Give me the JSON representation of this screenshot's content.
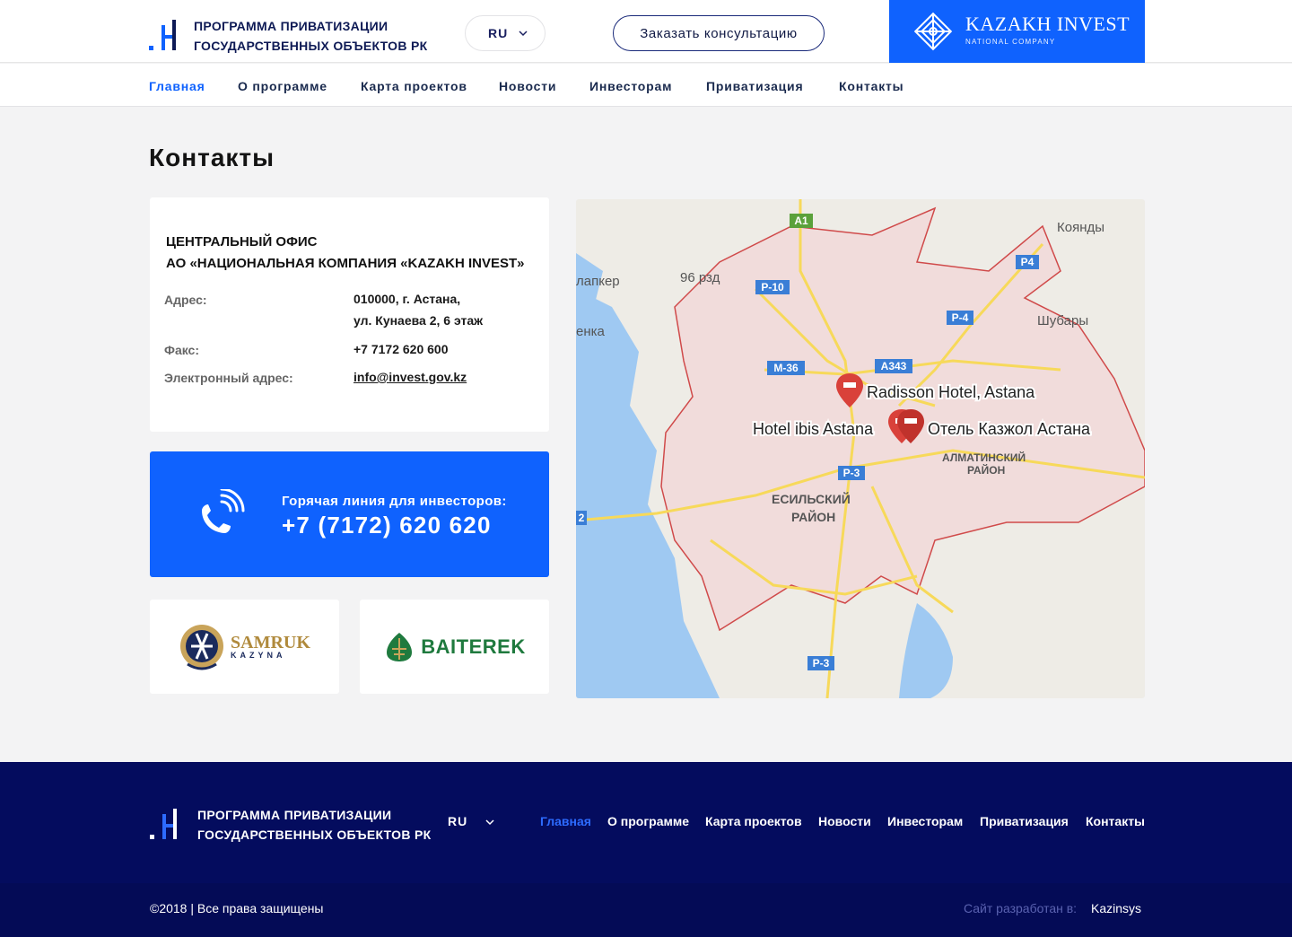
{
  "header": {
    "title_line1": "Программа приватизации",
    "title_line2": "государственных объектов РК",
    "lang": "RU",
    "consult_button": "Заказать консультацию",
    "kazakh_invest_name": "KAZAKH INVEST",
    "kazakh_invest_sub": "NATIONAL COMPANY"
  },
  "nav": {
    "items": [
      {
        "label": "Главная",
        "active": true
      },
      {
        "label": "О программе"
      },
      {
        "label": "Карта проектов"
      },
      {
        "label": "Новости"
      },
      {
        "label": "Инвесторам"
      },
      {
        "label": "Приватизация"
      },
      {
        "label": "Контакты"
      }
    ]
  },
  "main": {
    "page_title": "Контакты",
    "office": {
      "heading_line1": "Центральный офис",
      "heading_line2": "АО «Национальная компания «KAZAKH INVEST»",
      "address_label": "Адрес:",
      "address_line1": "010000, г. Астана,",
      "address_line2": "ул. Кунаева 2, 6 этаж",
      "fax_label": "Факс:",
      "fax_value": "+7 7172 620 600",
      "email_label": "Электронный адрес:",
      "email_value": "info@invest.gov.kz"
    },
    "hotline": {
      "label": "Горячая линия для инвесторов:",
      "number": "+7 (7172) 620 620"
    },
    "partners": {
      "samruk_line1": "SAMRUK",
      "samruk_line2": "KAZYNA",
      "baiterek": "BAITEREK"
    },
    "map": {
      "roads": [
        "A1",
        "P4",
        "P-10",
        "P-4",
        "M-36",
        "A343",
        "P-3",
        "P-3",
        "2"
      ],
      "places": [
        "Коянды",
        "96 рзд",
        "лапкер",
        "Шубары",
        "енка",
        "АЛМАТИНСКИЙ",
        "РАЙОН",
        "ЕСИЛЬСКИЙ",
        "РАЙОН"
      ],
      "hotels": [
        "Radisson Hotel, Astana",
        "Hotel ibis Astana",
        "Отель Казжол Астана"
      ]
    }
  },
  "footer": {
    "title_line1": "Программа приватизации",
    "title_line2": "государственных объектов РК",
    "lang": "RU",
    "nav": [
      "Главная",
      "О программе",
      "Карта проектов",
      "Новости",
      "Инвесторам",
      "Приватизация",
      "Контакты"
    ],
    "copyright": "©2018 | Все права защищены",
    "developer_label": "Сайт разработан в:",
    "developer_name": "Kazinsys"
  },
  "colors": {
    "accent": "#0f62fe",
    "footer_bg": "#040c5e",
    "page_bg": "#f3f3f4"
  }
}
